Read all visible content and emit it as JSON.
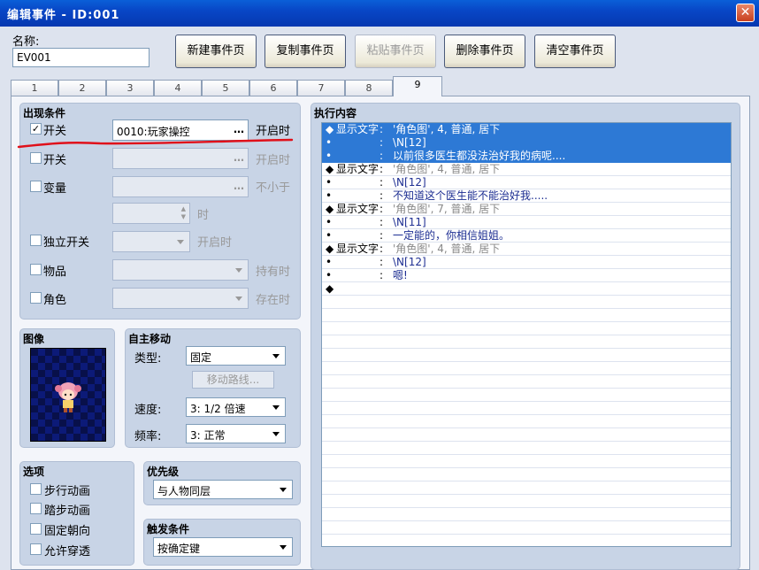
{
  "window": {
    "title": "编辑事件 - ID:001",
    "close": "✕"
  },
  "name": {
    "label": "名称:",
    "value": "EV001"
  },
  "toolbar": {
    "new_page": "新建事件页",
    "copy_page": "复制事件页",
    "paste_page": "粘贴事件页",
    "delete_page": "删除事件页",
    "clear_page": "清空事件页"
  },
  "tabs": [
    "1",
    "2",
    "3",
    "4",
    "5",
    "6",
    "7",
    "8",
    "9"
  ],
  "conditions": {
    "title": "出现条件",
    "switch1": {
      "label": "开关",
      "checked": "✓",
      "value": "0010:玩家操控",
      "suffix": "开启时"
    },
    "switch2": {
      "label": "开关",
      "value": "",
      "suffix": "开启时"
    },
    "variable": {
      "label": "变量",
      "value": "",
      "suffix": "不小于"
    },
    "variable_num": {
      "value": "",
      "suffix": "时"
    },
    "self_switch": {
      "label": "独立开关",
      "value": "",
      "suffix": "开启时"
    },
    "item": {
      "label": "物品",
      "value": "",
      "suffix": "持有时"
    },
    "actor": {
      "label": "角色",
      "value": "",
      "suffix": "存在时"
    }
  },
  "image": {
    "title": "图像"
  },
  "autonomous": {
    "title": "自主移动",
    "type_label": "类型:",
    "type_value": "固定",
    "route_button": "移动路线...",
    "speed_label": "速度:",
    "speed_value": "3: 1/2 倍速",
    "freq_label": "频率:",
    "freq_value": "3: 正常"
  },
  "options": {
    "title": "选项",
    "walk": "步行动画",
    "step": "踏步动画",
    "fixed_dir": "固定朝向",
    "through": "允许穿透"
  },
  "priority": {
    "title": "优先级",
    "value": "与人物同层"
  },
  "trigger": {
    "title": "触发条件",
    "value": "按确定键"
  },
  "exec": {
    "title": "执行内容",
    "rows": [
      {
        "bullet": "◆",
        "tag": "显示文字",
        "colon": ":",
        "text": "'角色图', 4, 普通, 居下"
      },
      {
        "bullet": "•",
        "tag": "",
        "colon": ":",
        "text": "\\N[12]"
      },
      {
        "bullet": "•",
        "tag": "",
        "colon": ":",
        "text": "以前很多医生都没法治好我的病呢...."
      },
      {
        "bullet": "◆",
        "tag": "显示文字",
        "colon": ":",
        "text": "'角色图', 4, 普通, 居下"
      },
      {
        "bullet": "•",
        "tag": "",
        "colon": ":",
        "text": "\\N[12]"
      },
      {
        "bullet": "•",
        "tag": "",
        "colon": ":",
        "text": "不知道这个医生能不能治好我....."
      },
      {
        "bullet": "◆",
        "tag": "显示文字",
        "colon": ":",
        "text": "'角色图', 7, 普通, 居下"
      },
      {
        "bullet": "•",
        "tag": "",
        "colon": ":",
        "text": "\\N[11]"
      },
      {
        "bullet": "•",
        "tag": "",
        "colon": ":",
        "text": "一定能的，你相信姐姐。"
      },
      {
        "bullet": "◆",
        "tag": "显示文字",
        "colon": ":",
        "text": "'角色图', 4, 普通, 居下"
      },
      {
        "bullet": "•",
        "tag": "",
        "colon": ":",
        "text": "\\N[12]"
      },
      {
        "bullet": "•",
        "tag": "",
        "colon": ":",
        "text": "嗯!"
      },
      {
        "bullet": "◆",
        "tag": "",
        "colon": "",
        "text": ""
      }
    ]
  },
  "colors": {
    "selection": "#2d79d5",
    "annotation": "#e0101a",
    "title_bar": "#0846c6"
  }
}
